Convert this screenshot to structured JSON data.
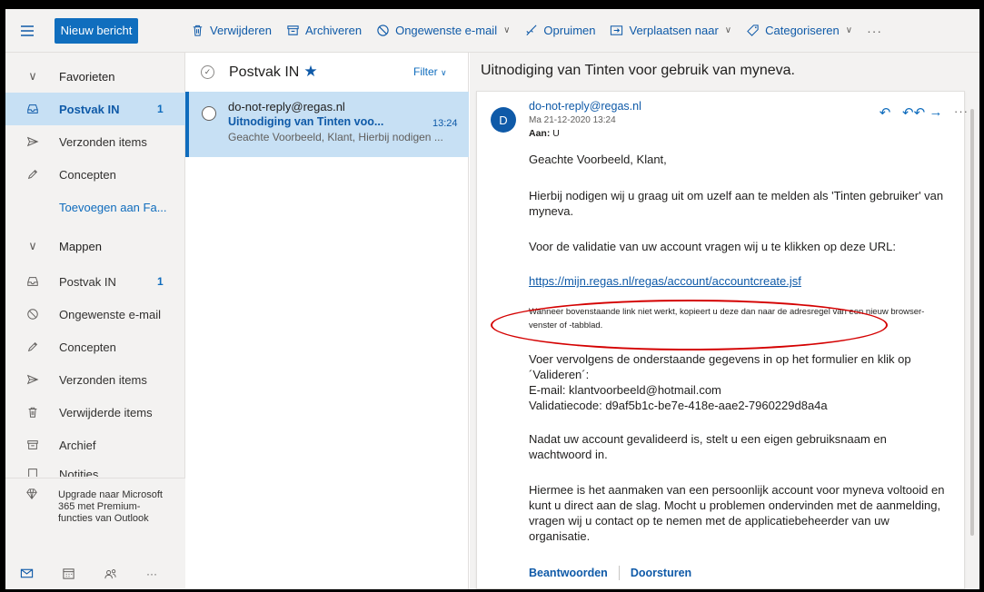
{
  "toolbar": {
    "new_message": "Nieuw bericht",
    "delete": "Verwijderen",
    "archive": "Archiveren",
    "junk": "Ongewenste e-mail",
    "sweep": "Opruimen",
    "move_to": "Verplaatsen naar",
    "categorize": "Categoriseren",
    "more": "···"
  },
  "nav": {
    "favorites": "Favorieten",
    "fav_inbox": "Postvak IN",
    "fav_inbox_count": "1",
    "fav_sent": "Verzonden items",
    "fav_drafts": "Concepten",
    "add_favorite": "Toevoegen aan Fa...",
    "folders": "Mappen",
    "inbox": "Postvak IN",
    "inbox_count": "1",
    "junk": "Ongewenste e-mail",
    "drafts": "Concepten",
    "sent": "Verzonden items",
    "deleted": "Verwijderde items",
    "archive": "Archief",
    "notes": "Notities",
    "upgrade": "Upgrade naar Microsoft 365 met Premium-functies van Outlook"
  },
  "list": {
    "title": "Postvak IN",
    "filter": "Filter",
    "items": [
      {
        "from": "do-not-reply@regas.nl",
        "subject": "Uitnodiging van Tinten voo...",
        "time": "13:24",
        "preview": "Geachte Voorbeeld, Klant, Hierbij nodigen ..."
      }
    ]
  },
  "reading": {
    "title": "Uitnodiging van Tinten voor gebruik van myneva.",
    "avatar_initial": "D",
    "sender": "do-not-reply@regas.nl",
    "date": "Ma 21-12-2020 13:24",
    "to_label": "Aan:",
    "to_value": "U",
    "greeting": "Geachte Voorbeeld, Klant,",
    "p1": "Hierbij nodigen wij u graag uit om uzelf aan te melden als 'Tinten gebruiker' van myneva.",
    "p2": "Voor de validatie van uw account vragen wij u te klikken op deze URL:",
    "link": "https://mijn.regas.nl/regas/account/accountcreate.jsf",
    "p3": "Wanneer bovenstaande link niet werkt, kopieert u deze dan naar de adresregel van een nieuw browser-venster of -tabblad.",
    "p4": "Voer vervolgens de onderstaande gegevens in op het formulier en klik op ´Valideren´:",
    "email_line": "E-mail: klantvoorbeeld@hotmail.com",
    "code_line": "Validatiecode: d9af5b1c-be7e-418e-aae2-7960229d8a4a",
    "p5": "Nadat uw account gevalideerd is, stelt u een eigen gebruiksnaam en wachtwoord in.",
    "p6": "Hiermee is het aanmaken van een persoonlijk account voor myneva voltooid en kunt u direct aan de slag. Mocht u problemen ondervinden met de aanmelding, vragen wij u contact op te nemen met de applicatiebeheerder van uw organisatie.",
    "reply": "Beantwoorden",
    "forward": "Doorsturen"
  },
  "colors": {
    "accent": "#0f5aa8",
    "selected_bg": "#c7e0f4",
    "annotation": "#d40000"
  }
}
